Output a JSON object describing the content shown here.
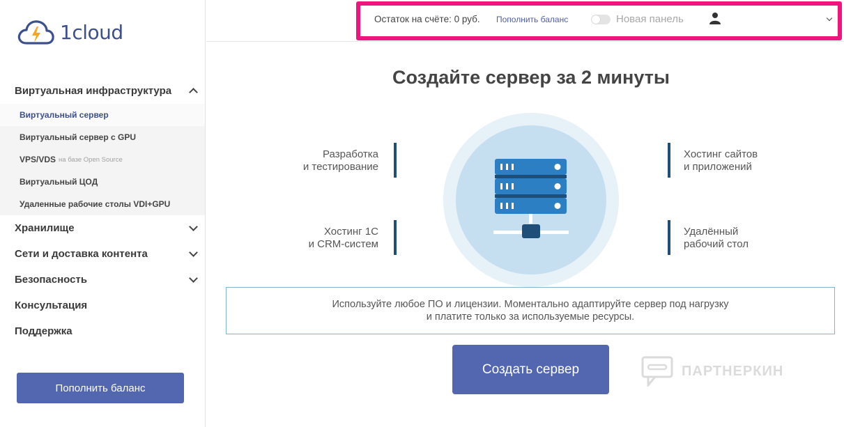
{
  "brand": {
    "name": "1cloud",
    "accent": "#5366b0",
    "bolt_color": "#f5a623",
    "cloud_color": "#3c4f8f"
  },
  "sidebar": {
    "groups": [
      {
        "label": "Виртуальная инфраструктура",
        "expanded": true,
        "items": [
          {
            "label": "Виртуальный сервер",
            "active": true
          },
          {
            "label": "Виртуальный сервер с GPU"
          },
          {
            "label": "VPS/VDS",
            "suffix": "на базе Open Source"
          },
          {
            "label": "Виртуальный ЦОД"
          },
          {
            "label": "Удаленные рабочие столы VDI+GPU"
          }
        ]
      },
      {
        "label": "Хранилище",
        "expanded": false
      },
      {
        "label": "Сети и доставка контента",
        "expanded": false
      },
      {
        "label": "Безопасность",
        "expanded": false
      }
    ],
    "links": [
      "Консультация",
      "Поддержка"
    ],
    "topup_button": "Пополнить баланс"
  },
  "topbar": {
    "balance_text": "Остаток на счёте: 0 руб.",
    "topup_link": "Пополнить баланс",
    "new_panel_label": "Новая панель",
    "new_panel_enabled": false,
    "user_icon": "user-icon",
    "highlight_color": "#f0147e"
  },
  "main": {
    "headline": "Создайте сервер за 2 минуты",
    "features": {
      "top_left": [
        "Разработка",
        "и тестирование"
      ],
      "bottom_left": [
        "Хостинг 1С",
        "и CRM-систем"
      ],
      "top_right": [
        "Хостинг сайтов",
        "и приложений"
      ],
      "bottom_right": [
        "Удалённый",
        "рабочий стол"
      ]
    },
    "info_text": "Используйте любое ПО и лицензии. Моментально адаптируйте сервер под нагрузку и платите только за используемые ресурсы.",
    "create_button": "Создать сервер"
  },
  "watermark": {
    "text": "ПАРТНЕРКИН"
  }
}
